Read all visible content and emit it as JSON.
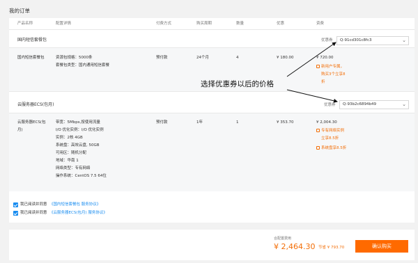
{
  "page_title": "我的订单",
  "columns": [
    "产品名称",
    "配置详情",
    "付费方式",
    "购买周期",
    "数量",
    "优惠",
    "资费"
  ],
  "orders": [
    {
      "group_title": "国内短信套餐包",
      "coupon_label": "优惠券",
      "coupon_value": "Q-91cd301c8fc3",
      "name": "国内短信套餐包",
      "config": [
        "资源包规格：5000条",
        "套餐包类型：国内通用短信套餐"
      ],
      "pay_type": "预付款",
      "period": "24个月",
      "qty": "4",
      "discount": "¥ 180.00",
      "price": "¥ 720.00",
      "promos": [
        "新用户专属，",
        "购买3个立享8",
        "折"
      ]
    },
    {
      "group_title": "云服务器ECS(包月)",
      "coupon_label": "优惠券",
      "coupon_value": "Q-93b2c6894b49",
      "name_lines": [
        "云服务器ECS(包",
        "月)"
      ],
      "config": [
        "带宽：5Mbps,按使用流量",
        "I/O 优化实例：I/O 优化实例",
        "实例：2核 4GB",
        "系统盘：高效云盘, 50GB",
        "可用区：随机分配",
        "地域：华南 1",
        "网络类型：专有网络",
        "操作系统：CentOS 7.5 64位"
      ],
      "pay_type": "预付款",
      "period": "1年",
      "qty": "1",
      "discount": "¥ 353.70",
      "price": "¥ 2,004.30",
      "promos": [
        "专有网络实例",
        "立享8.5折",
        "系统盘享8.5折"
      ]
    }
  ],
  "annotation": "选择优惠券以后的价格",
  "agreements": [
    {
      "prefix": "我已阅读并同意",
      "link": "《国内短信套餐包 服务协议》"
    },
    {
      "prefix": "我已阅读并同意",
      "link": "《云服务器ECS(包月) 服务协议》"
    }
  ],
  "footer": {
    "total_label": "合配置费用",
    "total": "¥ 2,464.30",
    "saved": "节省 ¥ 793.70",
    "buy_button": "确认购买"
  }
}
